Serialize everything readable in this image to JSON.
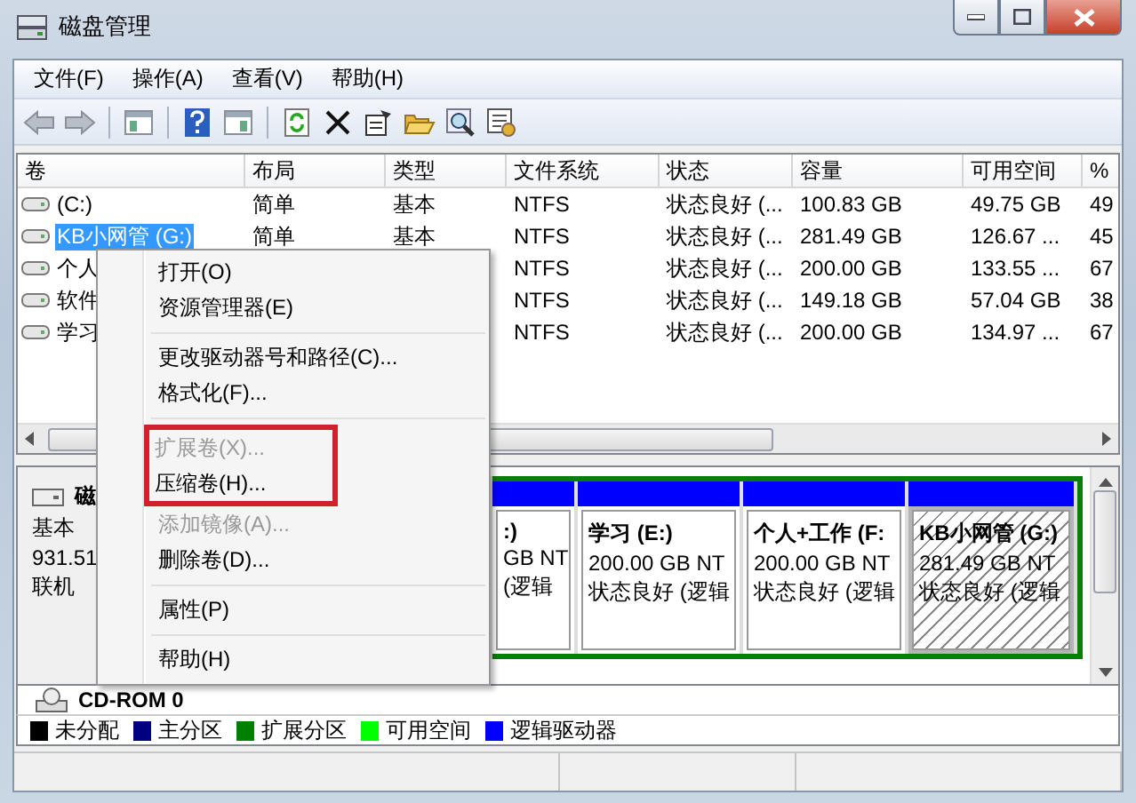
{
  "window": {
    "title": "磁盘管理"
  },
  "menu_bar": [
    "文件(F)",
    "操作(A)",
    "查看(V)",
    "帮助(H)"
  ],
  "volume_list": {
    "columns": [
      "卷",
      "布局",
      "类型",
      "文件系统",
      "状态",
      "容量",
      "可用空间",
      "%"
    ],
    "rows": [
      {
        "volume": "(C:)",
        "layout": "简单",
        "type": "基本",
        "file_system": "NTFS",
        "status": "状态良好 (...",
        "capacity": "100.83 GB",
        "free": "49.75 GB",
        "percent": "49",
        "selected": false
      },
      {
        "volume": "KB小网管 (G:)",
        "layout": "简单",
        "type": "基本",
        "file_system": "NTFS",
        "status": "状态良好 (...",
        "capacity": "281.49 GB",
        "free": "126.67 ...",
        "percent": "45",
        "selected": true
      },
      {
        "volume": "个人",
        "file_system": "NTFS",
        "status": "状态良好 (...",
        "capacity": "200.00 GB",
        "free": "133.55 ...",
        "percent": "67",
        "selected": false
      },
      {
        "volume": "软件",
        "file_system": "NTFS",
        "status": "状态良好 (...",
        "capacity": "149.18 GB",
        "free": "57.04 GB",
        "percent": "38",
        "selected": false
      },
      {
        "volume": "学习",
        "file_system": "NTFS",
        "status": "状态良好 (...",
        "capacity": "200.00 GB",
        "free": "134.97 ...",
        "percent": "67",
        "selected": false
      }
    ]
  },
  "disk": {
    "name": "磁",
    "type": "基本",
    "size": "931.51",
    "state": "联机",
    "partitions": [
      {
        "title": ":)",
        "size": "GB NT",
        "status": "(逻辑",
        "selected": false
      },
      {
        "title": "学习  (E:)",
        "size": "200.00 GB NT",
        "status": "状态良好 (逻辑",
        "selected": false
      },
      {
        "title": "个人+工作  (F:",
        "size": "200.00 GB NT",
        "status": "状态良好 (逻辑",
        "selected": false
      },
      {
        "title": "KB小网管  (G:)",
        "size": "281.49 GB NT",
        "status": "状态良好 (逻辑",
        "selected": true
      }
    ]
  },
  "cdrom": {
    "name": "CD-ROM 0"
  },
  "legend": [
    {
      "label": "未分配",
      "color": "#000000"
    },
    {
      "label": "主分区",
      "color": "#000080"
    },
    {
      "label": "扩展分区",
      "color": "#008000"
    },
    {
      "label": "可用空间",
      "color": "#00ff00"
    },
    {
      "label": "逻辑驱动器",
      "color": "#0000ff"
    }
  ],
  "context_menu": [
    {
      "kind": "item",
      "label": "打开(O)",
      "disabled": false,
      "highlighted": false
    },
    {
      "kind": "item",
      "label": "资源管理器(E)",
      "disabled": false,
      "highlighted": false
    },
    {
      "kind": "separator"
    },
    {
      "kind": "item",
      "label": "更改驱动器号和路径(C)...",
      "disabled": false,
      "highlighted": false
    },
    {
      "kind": "item",
      "label": "格式化(F)...",
      "disabled": false,
      "highlighted": false
    },
    {
      "kind": "separator"
    },
    {
      "kind": "item",
      "label": "扩展卷(X)...",
      "disabled": true,
      "highlighted": true
    },
    {
      "kind": "item",
      "label": "压缩卷(H)...",
      "disabled": false,
      "highlighted": true
    },
    {
      "kind": "item",
      "label": "添加镜像(A)...",
      "disabled": true,
      "highlighted": false
    },
    {
      "kind": "item",
      "label": "删除卷(D)...",
      "disabled": false,
      "highlighted": false
    },
    {
      "kind": "separator"
    },
    {
      "kind": "item",
      "label": "属性(P)",
      "disabled": false,
      "highlighted": false
    },
    {
      "kind": "separator"
    },
    {
      "kind": "item",
      "label": "帮助(H)",
      "disabled": false,
      "highlighted": false
    }
  ]
}
